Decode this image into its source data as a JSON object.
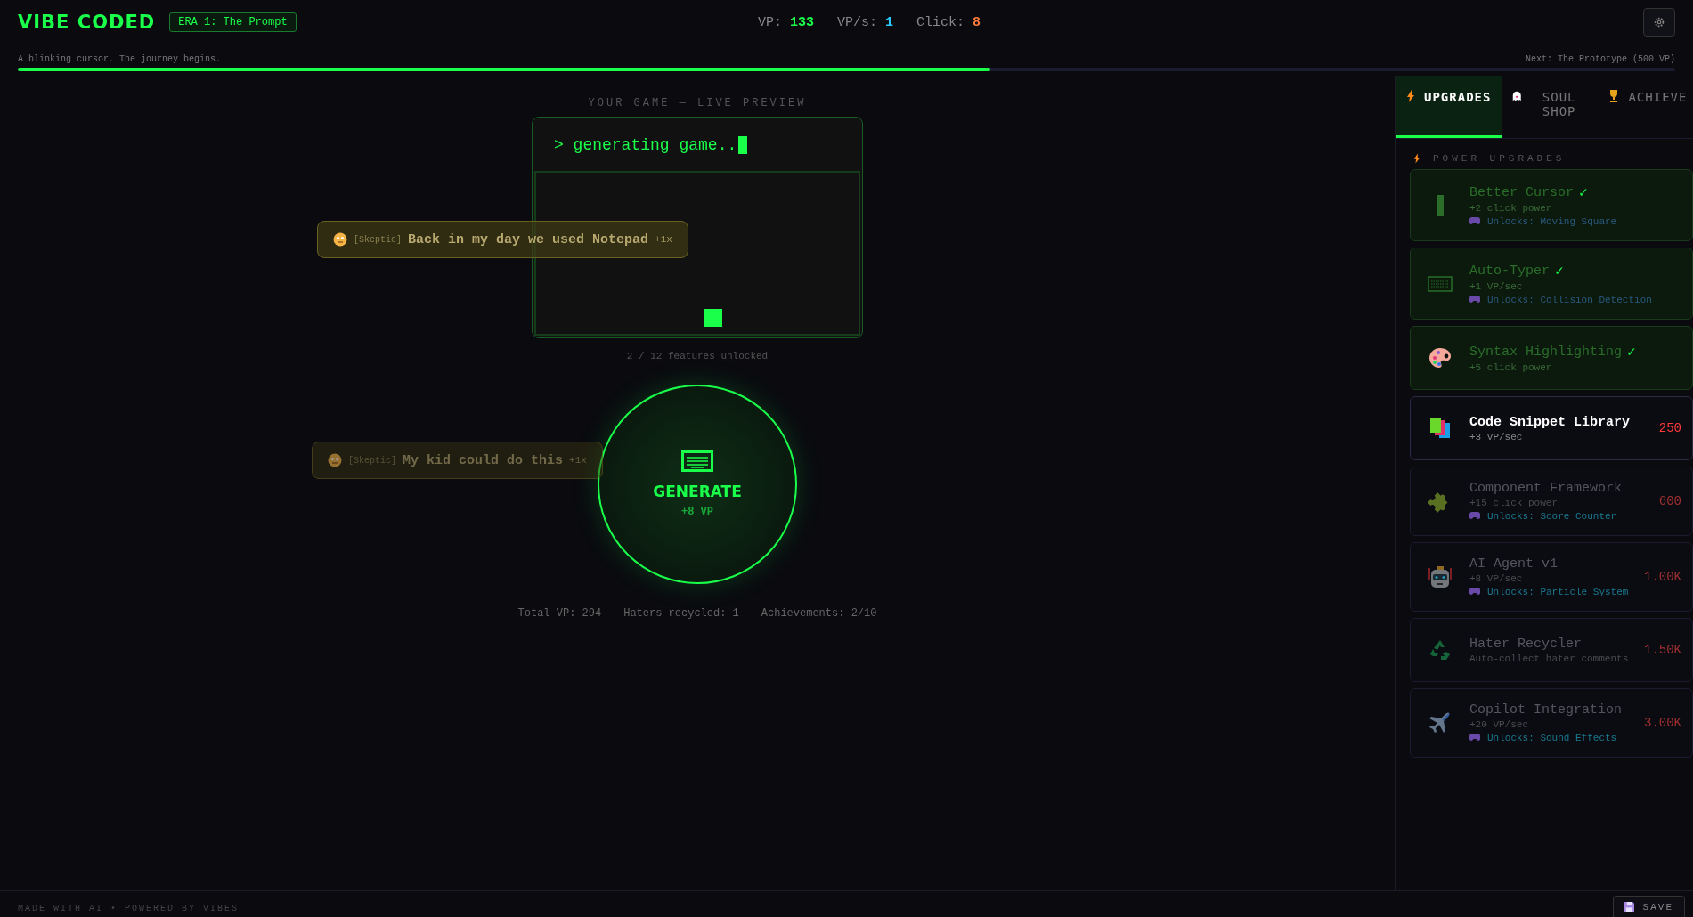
{
  "header": {
    "logo": "VIBE CODED",
    "era": "ERA 1: The Prompt",
    "stats": [
      {
        "label": "VP:",
        "value": "133",
        "kind": "vp"
      },
      {
        "label": "VP/s:",
        "value": "1",
        "kind": "rate"
      },
      {
        "label": "Click:",
        "value": "8",
        "kind": "click"
      }
    ]
  },
  "progress": {
    "caption": "A blinking cursor. The journey begins.",
    "next": "Next: The Prototype (500 VP)",
    "level": 0.587
  },
  "preview": {
    "title": "YOUR GAME — LIVE PREVIEW",
    "prompt": ">",
    "status": "generating game..",
    "features": "2 / 12 features unlocked"
  },
  "haters": [
    {
      "tag": "[Skeptic]",
      "text": "Back in my day we used Notepad",
      "multiplier": "+1x",
      "faded": false
    },
    {
      "tag": "[Skeptic]",
      "text": "My kid could do this",
      "multiplier": "+1x",
      "faded": true
    }
  ],
  "generate": {
    "label": "GENERATE",
    "gain": "+8 VP"
  },
  "totals": [
    "Total VP: 294",
    "Haters recycled: 1",
    "Achievements: 2/10"
  ],
  "tabs": [
    {
      "label": "UPGRADES",
      "selected": true
    },
    {
      "label": "SOUL SHOP",
      "selected": false
    },
    {
      "label": "ACHIEVE",
      "selected": false
    }
  ],
  "section": "POWER UPGRADES",
  "upgrades": [
    {
      "name": "Better Cursor",
      "check": "✓",
      "effect": "+2 click power",
      "unlock": "Unlocks: Moving Square",
      "owned": true
    },
    {
      "name": "Auto-Typer",
      "check": "✓",
      "effect": "+1 VP/sec",
      "unlock": "Unlocks: Collision Detection",
      "owned": true
    },
    {
      "name": "Syntax Highlighting",
      "check": "✓",
      "effect": "+5 click power",
      "owned": true
    },
    {
      "name": "Code Snippet Library",
      "effect": "+3 VP/sec",
      "cost": "250",
      "owned": false,
      "affordable": true
    },
    {
      "name": "Component Framework",
      "effect": "+15 click power",
      "unlock": "Unlocks: Score Counter",
      "cost": "600",
      "owned": false,
      "affordable": false
    },
    {
      "name": "AI Agent v1",
      "effect": "+8 VP/sec",
      "unlock": "Unlocks: Particle System",
      "cost": "1.00K",
      "owned": false,
      "affordable": false
    },
    {
      "name": "Hater Recycler",
      "effect": "Auto-collect hater comments",
      "cost": "1.50K",
      "owned": false,
      "affordable": false
    },
    {
      "name": "Copilot Integration",
      "effect": "+20 VP/sec",
      "unlock": "Unlocks: Sound Effects",
      "cost": "3.00K",
      "owned": false,
      "affordable": false
    }
  ],
  "footer": {
    "credit": "MADE WITH AI • POWERED BY VIBES",
    "save": "SAVE"
  }
}
